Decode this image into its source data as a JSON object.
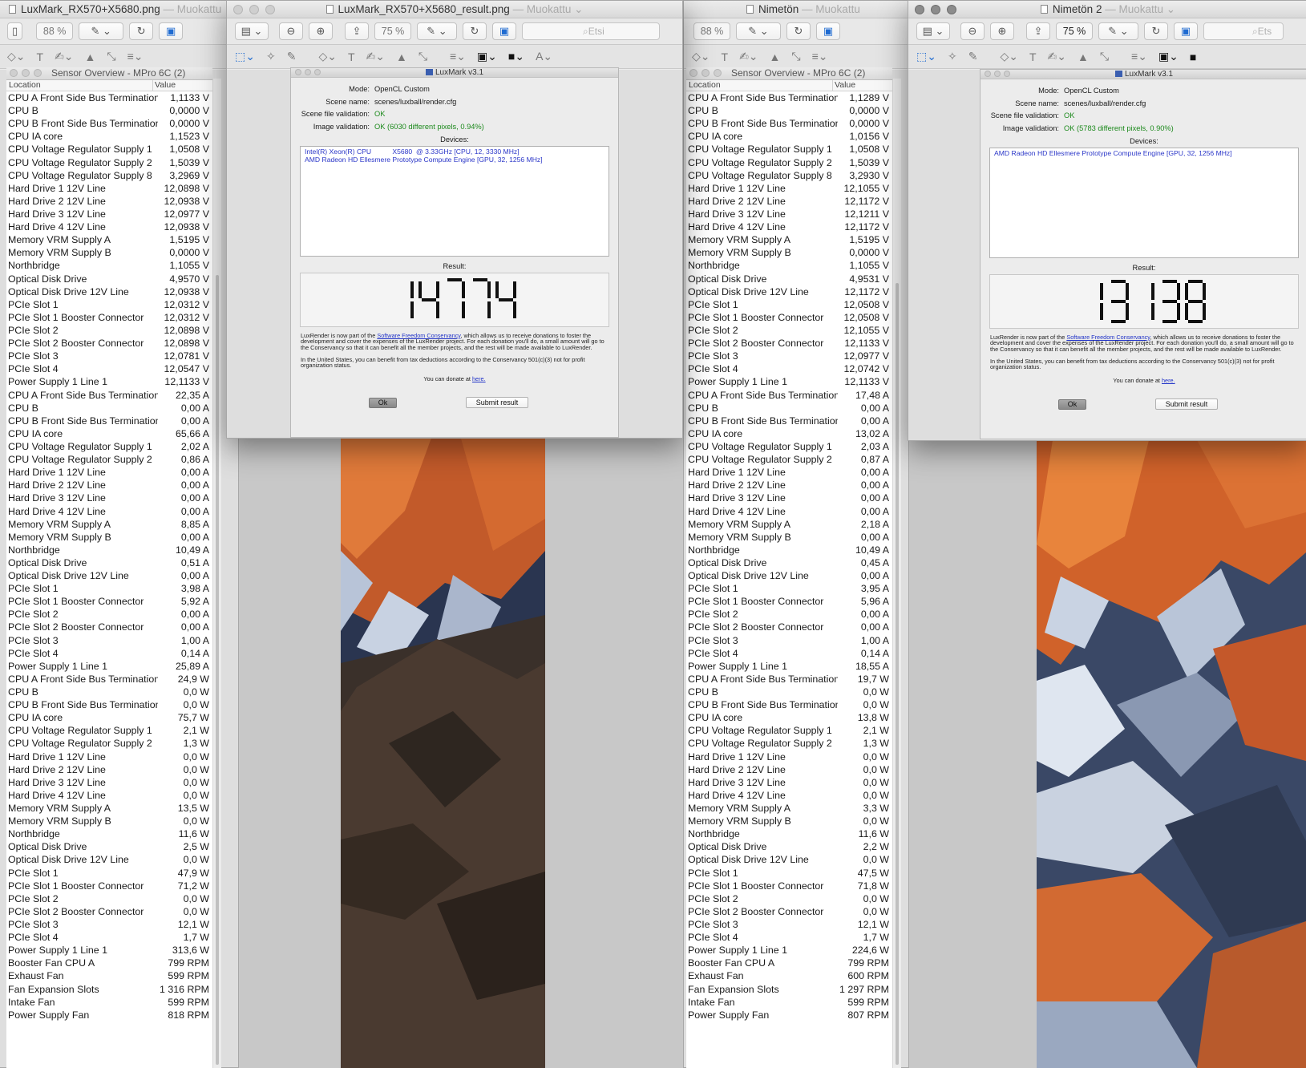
{
  "windows": {
    "w1": {
      "title": "LuxMark_RX570+X5680.png",
      "status": "— Muokattu",
      "zoom": "88 %"
    },
    "w2": {
      "title": "LuxMark_RX570+X5680_result.png",
      "status": "— Muokattu",
      "zoom": "75 %",
      "search_placeholder": "Etsi"
    },
    "w3": {
      "title": "Nimetön",
      "status": "— Muokattu",
      "zoom": "88 %"
    },
    "w4": {
      "title": "Nimetön 2",
      "status": "— Muokattu",
      "zoom": "75 %",
      "search_placeholder": "Ets"
    }
  },
  "sensor_left": {
    "title": "Sensor Overview - MPro 6C (2)",
    "col_location": "Location",
    "col_value": "Value",
    "rows": [
      [
        "CPU A Front Side Bus Termination",
        "1,1133 V"
      ],
      [
        "CPU B",
        "0,0000 V"
      ],
      [
        "CPU B Front Side Bus Termination",
        "0,0000 V"
      ],
      [
        "CPU IA core",
        "1,1523 V"
      ],
      [
        "CPU Voltage Regulator Supply 1",
        "1,0508 V"
      ],
      [
        "CPU Voltage Regulator Supply 2",
        "1,5039 V"
      ],
      [
        "CPU Voltage Regulator Supply 8",
        "3,2969 V"
      ],
      [
        "Hard Drive 1 12V Line",
        "12,0898 V"
      ],
      [
        "Hard Drive 2 12V Line",
        "12,0938 V"
      ],
      [
        "Hard Drive 3 12V Line",
        "12,0977 V"
      ],
      [
        "Hard Drive 4 12V Line",
        "12,0938 V"
      ],
      [
        "Memory VRM Supply A",
        "1,5195 V"
      ],
      [
        "Memory VRM Supply B",
        "0,0000 V"
      ],
      [
        "Northbridge",
        "1,1055 V"
      ],
      [
        "Optical Disk Drive",
        "4,9570 V"
      ],
      [
        "Optical Disk Drive 12V Line",
        "12,0938 V"
      ],
      [
        "PCIe Slot 1",
        "12,0312 V"
      ],
      [
        "PCIe Slot 1 Booster Connector",
        "12,0312 V"
      ],
      [
        "PCIe Slot 2",
        "12,0898 V"
      ],
      [
        "PCIe Slot 2 Booster Connector",
        "12,0898 V"
      ],
      [
        "PCIe Slot 3",
        "12,0781 V"
      ],
      [
        "PCIe Slot 4",
        "12,0547 V"
      ],
      [
        "Power Supply 1 Line 1",
        "12,1133 V"
      ],
      [
        "CPU A Front Side Bus Termination",
        "22,35 A"
      ],
      [
        "CPU B",
        "0,00 A"
      ],
      [
        "CPU B Front Side Bus Termination",
        "0,00 A"
      ],
      [
        "CPU IA core",
        "65,66 A"
      ],
      [
        "CPU Voltage Regulator Supply 1",
        "2,02 A"
      ],
      [
        "CPU Voltage Regulator Supply 2",
        "0,86 A"
      ],
      [
        "Hard Drive 1 12V Line",
        "0,00 A"
      ],
      [
        "Hard Drive 2 12V Line",
        "0,00 A"
      ],
      [
        "Hard Drive 3 12V Line",
        "0,00 A"
      ],
      [
        "Hard Drive 4 12V Line",
        "0,00 A"
      ],
      [
        "Memory VRM Supply A",
        "8,85 A"
      ],
      [
        "Memory VRM Supply B",
        "0,00 A"
      ],
      [
        "Northbridge",
        "10,49 A"
      ],
      [
        "Optical Disk Drive",
        "0,51 A"
      ],
      [
        "Optical Disk Drive 12V Line",
        "0,00 A"
      ],
      [
        "PCIe Slot 1",
        "3,98 A"
      ],
      [
        "PCIe Slot 1 Booster Connector",
        "5,92 A"
      ],
      [
        "PCIe Slot 2",
        "0,00 A"
      ],
      [
        "PCIe Slot 2 Booster Connector",
        "0,00 A"
      ],
      [
        "PCIe Slot 3",
        "1,00 A"
      ],
      [
        "PCIe Slot 4",
        "0,14 A"
      ],
      [
        "Power Supply 1 Line 1",
        "25,89 A"
      ],
      [
        "CPU A Front Side Bus Termination",
        "24,9 W"
      ],
      [
        "CPU B",
        "0,0 W"
      ],
      [
        "CPU B Front Side Bus Termination",
        "0,0 W"
      ],
      [
        "CPU IA core",
        "75,7 W"
      ],
      [
        "CPU Voltage Regulator Supply 1",
        "2,1 W"
      ],
      [
        "CPU Voltage Regulator Supply 2",
        "1,3 W"
      ],
      [
        "Hard Drive 1 12V Line",
        "0,0 W"
      ],
      [
        "Hard Drive 2 12V Line",
        "0,0 W"
      ],
      [
        "Hard Drive 3 12V Line",
        "0,0 W"
      ],
      [
        "Hard Drive 4 12V Line",
        "0,0 W"
      ],
      [
        "Memory VRM Supply A",
        "13,5 W"
      ],
      [
        "Memory VRM Supply B",
        "0,0 W"
      ],
      [
        "Northbridge",
        "11,6 W"
      ],
      [
        "Optical Disk Drive",
        "2,5 W"
      ],
      [
        "Optical Disk Drive 12V Line",
        "0,0 W"
      ],
      [
        "PCIe Slot 1",
        "47,9 W"
      ],
      [
        "PCIe Slot 1 Booster Connector",
        "71,2 W"
      ],
      [
        "PCIe Slot 2",
        "0,0 W"
      ],
      [
        "PCIe Slot 2 Booster Connector",
        "0,0 W"
      ],
      [
        "PCIe Slot 3",
        "12,1 W"
      ],
      [
        "PCIe Slot 4",
        "1,7 W"
      ],
      [
        "Power Supply 1 Line 1",
        "313,6 W"
      ],
      [
        "Booster Fan CPU A",
        "799 RPM"
      ],
      [
        "Exhaust Fan",
        "599 RPM"
      ],
      [
        "Fan Expansion Slots",
        "1 316 RPM"
      ],
      [
        "Intake Fan",
        "599 RPM"
      ],
      [
        "Power Supply Fan",
        "818 RPM"
      ]
    ]
  },
  "sensor_right": {
    "title": "Sensor Overview - MPro 6C (2)",
    "col_location": "Location",
    "col_value": "Value",
    "rows": [
      [
        "CPU A Front Side Bus Termination",
        "1,1289 V"
      ],
      [
        "CPU B",
        "0,0000 V"
      ],
      [
        "CPU B Front Side Bus Termination",
        "0,0000 V"
      ],
      [
        "CPU IA core",
        "1,0156 V"
      ],
      [
        "CPU Voltage Regulator Supply 1",
        "1,0508 V"
      ],
      [
        "CPU Voltage Regulator Supply 2",
        "1,5039 V"
      ],
      [
        "CPU Voltage Regulator Supply 8",
        "3,2930 V"
      ],
      [
        "Hard Drive 1 12V Line",
        "12,1055 V"
      ],
      [
        "Hard Drive 2 12V Line",
        "12,1172 V"
      ],
      [
        "Hard Drive 3 12V Line",
        "12,1211 V"
      ],
      [
        "Hard Drive 4 12V Line",
        "12,1172 V"
      ],
      [
        "Memory VRM Supply A",
        "1,5195 V"
      ],
      [
        "Memory VRM Supply B",
        "0,0000 V"
      ],
      [
        "Northbridge",
        "1,1055 V"
      ],
      [
        "Optical Disk Drive",
        "4,9531 V"
      ],
      [
        "Optical Disk Drive 12V Line",
        "12,1172 V"
      ],
      [
        "PCIe Slot 1",
        "12,0508 V"
      ],
      [
        "PCIe Slot 1 Booster Connector",
        "12,0508 V"
      ],
      [
        "PCIe Slot 2",
        "12,1055 V"
      ],
      [
        "PCIe Slot 2 Booster Connector",
        "12,1133 V"
      ],
      [
        "PCIe Slot 3",
        "12,0977 V"
      ],
      [
        "PCIe Slot 4",
        "12,0742 V"
      ],
      [
        "Power Supply 1 Line 1",
        "12,1133 V"
      ],
      [
        "CPU A Front Side Bus Termination",
        "17,48 A"
      ],
      [
        "CPU B",
        "0,00 A"
      ],
      [
        "CPU B Front Side Bus Termination",
        "0,00 A"
      ],
      [
        "CPU IA core",
        "13,02 A"
      ],
      [
        "CPU Voltage Regulator Supply 1",
        "2,03 A"
      ],
      [
        "CPU Voltage Regulator Supply 2",
        "0,87 A"
      ],
      [
        "Hard Drive 1 12V Line",
        "0,00 A"
      ],
      [
        "Hard Drive 2 12V Line",
        "0,00 A"
      ],
      [
        "Hard Drive 3 12V Line",
        "0,00 A"
      ],
      [
        "Hard Drive 4 12V Line",
        "0,00 A"
      ],
      [
        "Memory VRM Supply A",
        "2,18 A"
      ],
      [
        "Memory VRM Supply B",
        "0,00 A"
      ],
      [
        "Northbridge",
        "10,49 A"
      ],
      [
        "Optical Disk Drive",
        "0,45 A"
      ],
      [
        "Optical Disk Drive 12V Line",
        "0,00 A"
      ],
      [
        "PCIe Slot 1",
        "3,95 A"
      ],
      [
        "PCIe Slot 1 Booster Connector",
        "5,96 A"
      ],
      [
        "PCIe Slot 2",
        "0,00 A"
      ],
      [
        "PCIe Slot 2 Booster Connector",
        "0,00 A"
      ],
      [
        "PCIe Slot 3",
        "1,00 A"
      ],
      [
        "PCIe Slot 4",
        "0,14 A"
      ],
      [
        "Power Supply 1 Line 1",
        "18,55 A"
      ],
      [
        "CPU A Front Side Bus Termination",
        "19,7 W"
      ],
      [
        "CPU B",
        "0,0 W"
      ],
      [
        "CPU B Front Side Bus Termination",
        "0,0 W"
      ],
      [
        "CPU IA core",
        "13,8 W"
      ],
      [
        "CPU Voltage Regulator Supply 1",
        "2,1 W"
      ],
      [
        "CPU Voltage Regulator Supply 2",
        "1,3 W"
      ],
      [
        "Hard Drive 1 12V Line",
        "0,0 W"
      ],
      [
        "Hard Drive 2 12V Line",
        "0,0 W"
      ],
      [
        "Hard Drive 3 12V Line",
        "0,0 W"
      ],
      [
        "Hard Drive 4 12V Line",
        "0,0 W"
      ],
      [
        "Memory VRM Supply A",
        "3,3 W"
      ],
      [
        "Memory VRM Supply B",
        "0,0 W"
      ],
      [
        "Northbridge",
        "11,6 W"
      ],
      [
        "Optical Disk Drive",
        "2,2 W"
      ],
      [
        "Optical Disk Drive 12V Line",
        "0,0 W"
      ],
      [
        "PCIe Slot 1",
        "47,5 W"
      ],
      [
        "PCIe Slot 1 Booster Connector",
        "71,8 W"
      ],
      [
        "PCIe Slot 2",
        "0,0 W"
      ],
      [
        "PCIe Slot 2 Booster Connector",
        "0,0 W"
      ],
      [
        "PCIe Slot 3",
        "12,1 W"
      ],
      [
        "PCIe Slot 4",
        "1,7 W"
      ],
      [
        "Power Supply 1 Line 1",
        "224,6 W"
      ],
      [
        "Booster Fan CPU A",
        "799 RPM"
      ],
      [
        "Exhaust Fan",
        "600 RPM"
      ],
      [
        "Fan Expansion Slots",
        "1 297 RPM"
      ],
      [
        "Intake Fan",
        "599 RPM"
      ],
      [
        "Power Supply Fan",
        "807 RPM"
      ]
    ]
  },
  "lux1": {
    "title": "LuxMark v3.1",
    "mode_label": "Mode:",
    "mode": "OpenCL Custom",
    "scene_label": "Scene name:",
    "scene": "scenes/luxball/render.cfg",
    "sfv_label": "Scene file validation:",
    "sfv": "OK",
    "iv_label": "Image validation:",
    "iv": "OK (6030 different pixels, 0.94%)",
    "devices_label": "Devices:",
    "devices": [
      "Intel(R) Xeon(R) CPU           X5680  @ 3.33GHz [CPU, 12, 3330 MHz]",
      "AMD Radeon HD Ellesmere Prototype Compute Engine [GPU, 32, 1256 MHz]"
    ],
    "result_label": "Result:",
    "result": "14774",
    "info1_pre": "LuxRender is now part of the ",
    "info1_link": "Software Freedom Conservancy",
    "info1_post": ", which allows us to receive donations to foster the development and cover the expenses of the LuxRender project. For each donation you'll do, a small amount will go to the Conservancy so that it can benefit all the member projects, and the rest will be made available to LuxRender.",
    "info2": "In the United States, you can benefit from tax deductions according to the Conservancy 501(c)(3) not for profit organization status.",
    "donate_pre": "You can donate at ",
    "donate_link": "here.",
    "ok_label": "Ok",
    "submit_label": "Submit result"
  },
  "lux2": {
    "title": "LuxMark v3.1",
    "mode_label": "Mode:",
    "mode": "OpenCL Custom",
    "scene_label": "Scene name:",
    "scene": "scenes/luxball/render.cfg",
    "sfv_label": "Scene file validation:",
    "sfv": "OK",
    "iv_label": "Image validation:",
    "iv": "OK (5783 different pixels, 0.90%)",
    "devices_label": "Devices:",
    "devices": [
      "AMD Radeon HD Ellesmere Prototype Compute Engine [GPU, 32, 1256 MHz]"
    ],
    "result_label": "Result:",
    "result": "13138",
    "info1_pre": "LuxRender is now part of the ",
    "info1_link": "Software Freedom Conservancy",
    "info1_post": ", which allows us to receive donations to foster the development and cover the expenses of the LuxRender project. For each donation you'll do, a small amount will go to the Conservancy so that it can benefit all the member projects, and the rest will be made available to LuxRender.",
    "info2": "In the United States, you can benefit from tax deductions according to the Conservancy 501(c)(3) not for profit organization status.",
    "donate_pre": "You can donate at ",
    "donate_link": "here.",
    "ok_label": "Ok",
    "submit_label": "Submit result"
  }
}
